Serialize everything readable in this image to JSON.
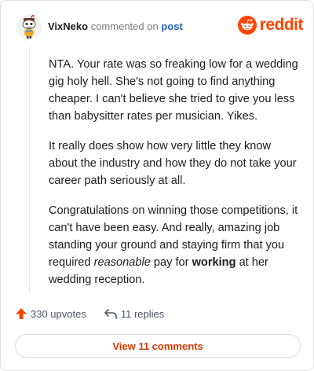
{
  "comment": {
    "author": "VixNeko",
    "action": "commented on",
    "post_link": "post",
    "brand": "reddit",
    "paragraphs": [
      [
        {
          "text": "NTA. Your rate was so freaking low for a wedding gig holy hell. She's not going to find anything cheaper. I can't believe she tried to give you less than babysitter rates per musician. Yikes.",
          "style": "normal"
        }
      ],
      [
        {
          "text": "It really does show how very little they know about the industry and how they do not take your career path seriously at all.",
          "style": "normal"
        }
      ],
      [
        {
          "text": "Congratulations on winning those competitions, it can't have been easy. And really, amazing job standing your ground and staying firm that you required ",
          "style": "normal"
        },
        {
          "text": "reasonable",
          "style": "italic"
        },
        {
          "text": " pay for ",
          "style": "normal"
        },
        {
          "text": "working",
          "style": "bold"
        },
        {
          "text": " at her wedding reception.",
          "style": "normal"
        }
      ]
    ]
  },
  "footer": {
    "upvotes": "330 upvotes",
    "replies": "11 replies",
    "view_comments": "View 11 comments"
  },
  "icons": {
    "avatar": "snoo-avatar-icon",
    "logo": "reddit-logo-icon",
    "upvote": "upvote-arrow-icon",
    "reply": "reply-arrow-icon"
  },
  "colors": {
    "brand_orange": "#ff4500",
    "link_blue": "#2563b8",
    "view_button_text": "#d93a00"
  }
}
